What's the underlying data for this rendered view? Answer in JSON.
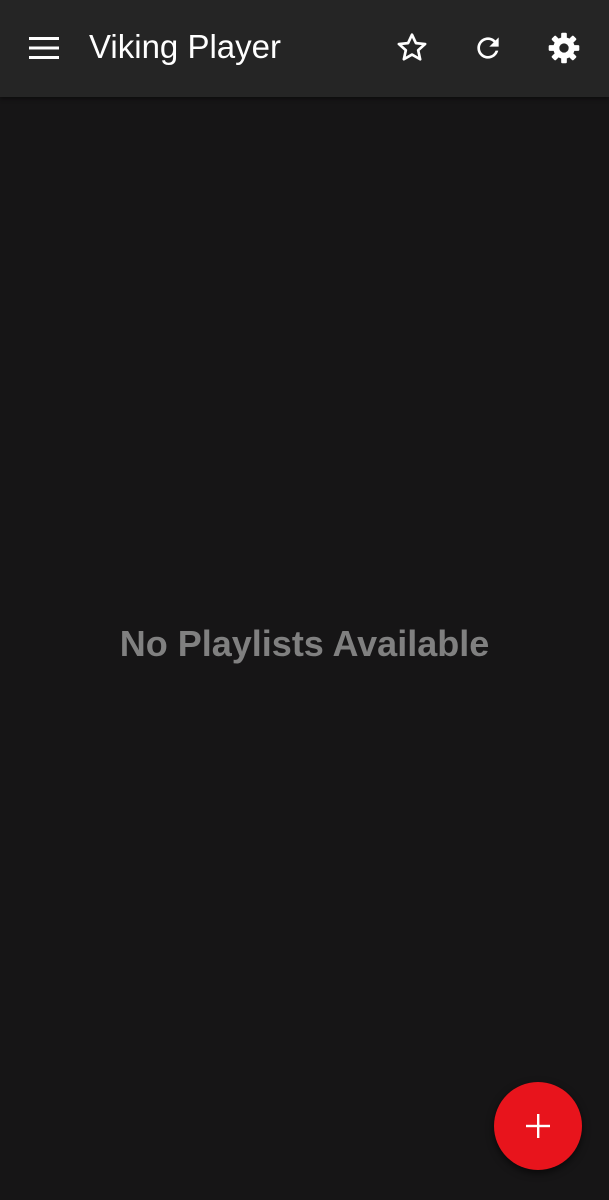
{
  "app_bar": {
    "title": "Viking Player",
    "menu_icon": "menu-icon",
    "actions": [
      {
        "icon": "star-outline-icon"
      },
      {
        "icon": "refresh-icon"
      },
      {
        "icon": "gear-icon"
      }
    ]
  },
  "content": {
    "empty_message": "No Playlists Available"
  },
  "fab": {
    "icon": "plus-icon"
  },
  "colors": {
    "background": "#161516",
    "toolbar": "#252525",
    "title_text": "#ffffff",
    "empty_text": "#808080",
    "accent": "#e8141c"
  }
}
